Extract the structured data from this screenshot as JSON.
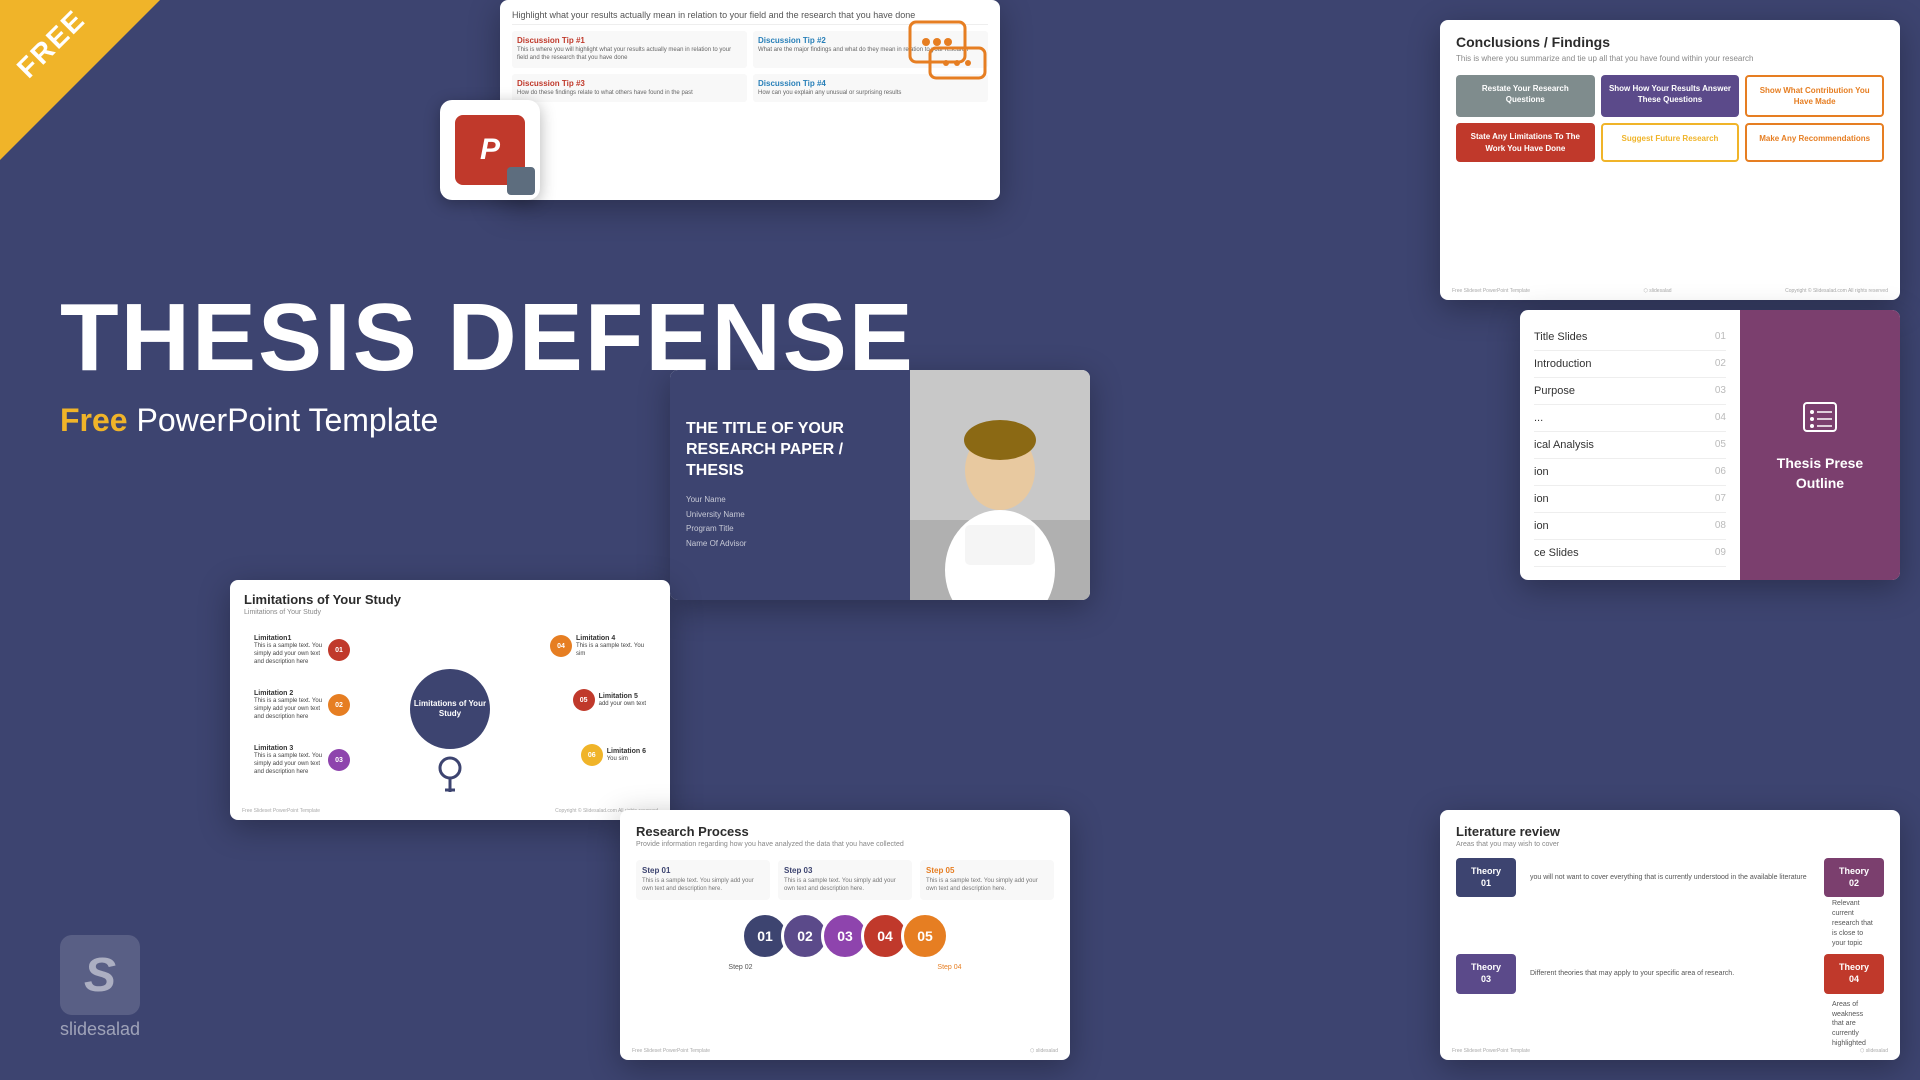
{
  "badge": {
    "free_label": "FREE"
  },
  "main_title": {
    "line1": "THESIS DEFENSE",
    "line2": "",
    "subtitle_free": "Free",
    "subtitle_rest": " PowerPoint Template"
  },
  "slidesalad": {
    "logo_letter": "S",
    "name": "slidesalad"
  },
  "discussion_slide": {
    "header": "Highlight what your results actually mean in relation to your field and the research that you have done",
    "tip1_title": "Discussion Tip #1",
    "tip1_text": "This is where you will highlight what your results actually mean in relation to your field and the research that you have done",
    "tip2_title": "Discussion Tip #2",
    "tip2_text": "What are the major findings and what do they mean in relation to your research",
    "tip3_title": "Discussion Tip #3",
    "tip3_text": "How do these findings relate to what others have found in the past",
    "tip4_title": "Discussion Tip #4",
    "tip4_text": "How can you explain any unusual or surprising results"
  },
  "conclusions_slide": {
    "title": "Conclusions / Findings",
    "subtitle": "This is where you summarize and tie up all that you have found within your research",
    "card1": "Restate Your Research Questions",
    "card2": "Show How Your Results Answer These Questions",
    "card3": "Show What Contribution You Have Made",
    "card4": "State Any Limitations To The Work You Have Done",
    "card5": "Suggest Future Research",
    "card6": "Make Any Recommendations",
    "footer_left": "Free Slideset PowerPoint Template",
    "footer_right": "Copyright © Slidesalad.com All rights reserved"
  },
  "toc_slide": {
    "items": [
      {
        "label": "Title Slides",
        "num": "01"
      },
      {
        "label": "Introduction",
        "num": "02"
      },
      {
        "label": "Purpose",
        "num": "03"
      },
      {
        "label": "...",
        "num": "04"
      },
      {
        "label": "ical Analysis",
        "num": "05"
      },
      {
        "label": "ion",
        "num": "06"
      },
      {
        "label": "ion",
        "num": "07"
      },
      {
        "label": "ion",
        "num": "08"
      },
      {
        "label": "ce Slides",
        "num": "09"
      }
    ],
    "right_title": "Thesis Prese Outline"
  },
  "title_page_slide": {
    "main_text": "THE TITLE OF YOUR RESEARCH PAPER / THESIS",
    "name": "Your Name",
    "university": "University Name",
    "program": "Program Title",
    "advisor": "Name Of Advisor"
  },
  "limitations_slide": {
    "title": "Limitations of Your Study",
    "subtitle": "Limitations of Your Study",
    "center_label": "Limitations of Your Study",
    "nodes": [
      {
        "label": "Limitation 1",
        "num": "01",
        "color": "#c0392b"
      },
      {
        "label": "Limitation 2",
        "num": "02",
        "color": "#e67e22"
      },
      {
        "label": "Limitation 3",
        "num": "03",
        "color": "#8e44ad"
      },
      {
        "label": "Limitation 4",
        "num": "04",
        "color": "#e67e22"
      },
      {
        "label": "Limitation 5",
        "num": "05",
        "color": "#c0392b"
      },
      {
        "label": "Limitation 6",
        "num": "06",
        "color": "#f0b429"
      }
    ]
  },
  "research_slide": {
    "title": "Research Process",
    "subtitle": "Provide information regarding how you have analyzed the data that you have collected",
    "steps": [
      {
        "label": "Step 01",
        "color": "#3d4470",
        "text": "This is a sample text. You simply add your own text and description here."
      },
      {
        "label": "Step 03",
        "color": "#3d4470",
        "text": "This is a sample text. You simply add your own text and description here."
      },
      {
        "label": "Step 05",
        "color": "#e67e22",
        "text": "This is a sample text. You simply add your own text and description here."
      }
    ],
    "circles": [
      {
        "num": "01",
        "color": "#3d4470"
      },
      {
        "num": "02",
        "color": "#5b4a8a"
      },
      {
        "num": "03",
        "color": "#8e44ad"
      },
      {
        "num": "04",
        "color": "#c0392b"
      },
      {
        "num": "05",
        "color": "#e67e22"
      }
    ],
    "step2_label": "Step 02",
    "step4_label": "Step 04"
  },
  "literature_slide": {
    "title": "Literature review",
    "subtitle": "Areas that you may wish to cover",
    "rows": [
      {
        "left_label": "Theory\n01",
        "left_color": "#3d4470",
        "desc_left": "you will not want to cover everything that is currently understood in the available literature",
        "right_label": "Theory\n02",
        "right_color": "#7b3f6e",
        "desc_right": "Relevant current research that is close to your topic"
      },
      {
        "left_label": "Theory\n03",
        "left_color": "#5b4a8a",
        "desc_left": "Different theories that may apply to your specific area of research.",
        "right_label": "Theory\n04",
        "right_color": "#c0392b",
        "desc_right": "Areas of weakness that are currently highlighted"
      }
    ]
  },
  "colors": {
    "bg": "#3d4470",
    "accent_yellow": "#f0b429",
    "accent_orange": "#e67e22",
    "accent_red": "#c0392b",
    "accent_purple": "#5b4a8a",
    "accent_mauve": "#7b3f6e"
  }
}
